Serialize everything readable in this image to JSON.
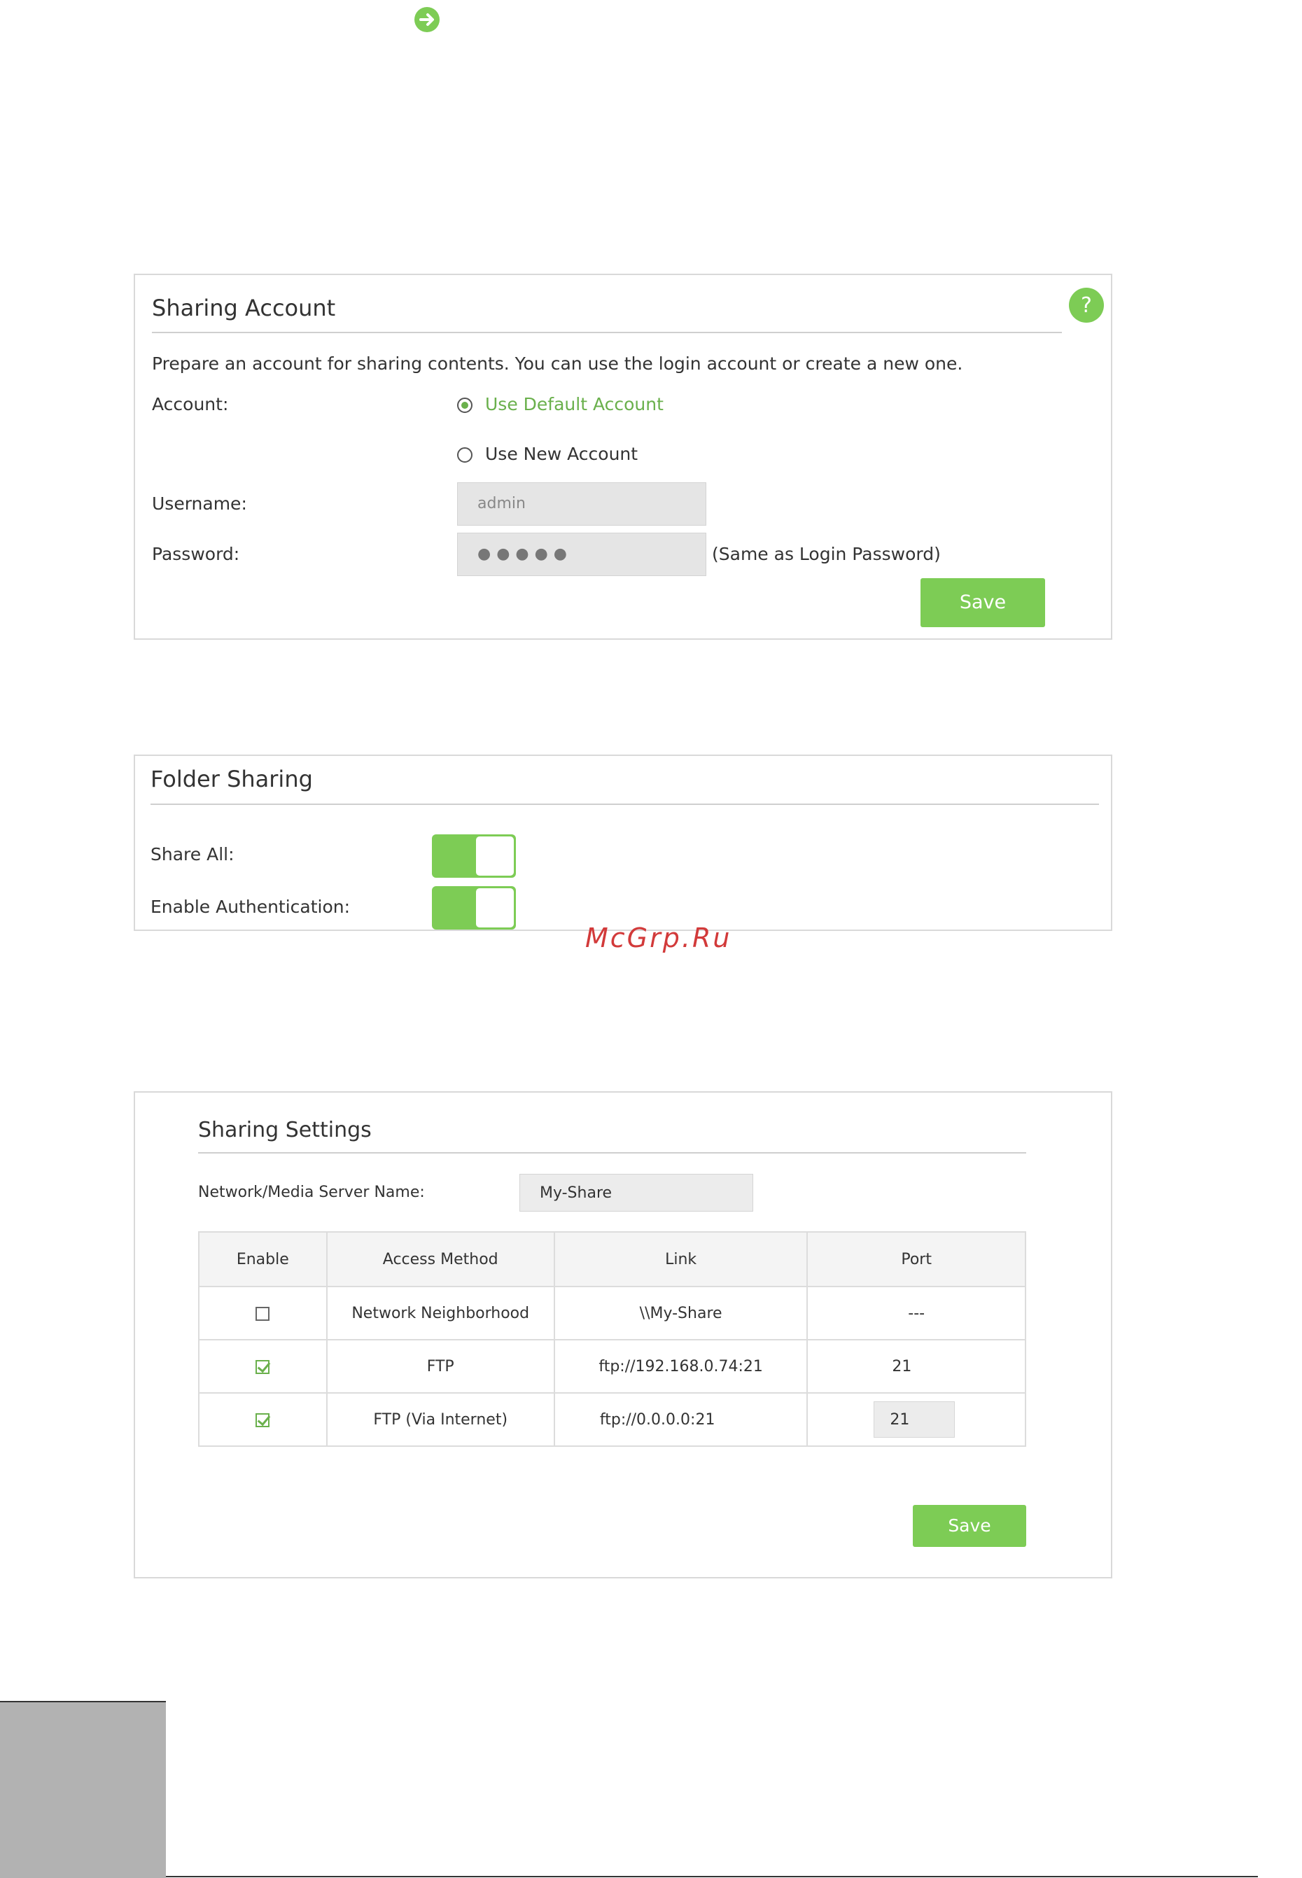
{
  "sharing_account": {
    "title": "Sharing Account",
    "description": "Prepare an account for sharing contents. You can use the login account or create a new one.",
    "account_label": "Account:",
    "option_default": "Use Default Account",
    "option_new": "Use New Account",
    "selected_option": "Use Default Account",
    "username_label": "Username:",
    "username_value": "admin",
    "password_label": "Password:",
    "password_value": "●●●●●",
    "password_note": "(Same as Login Password)",
    "save_label": "Save",
    "help_glyph": "?"
  },
  "folder_sharing": {
    "title": "Folder Sharing",
    "share_all_label": "Share All:",
    "share_all_on": true,
    "enable_auth_label": "Enable Authentication:",
    "enable_auth_on": true
  },
  "watermark": "McGrp.Ru",
  "sharing_settings": {
    "title": "Sharing Settings",
    "server_name_label": "Network/Media Server Name:",
    "server_name_value": "My-Share",
    "columns": [
      "Enable",
      "Access Method",
      "Link",
      "Port"
    ],
    "rows": [
      {
        "enabled": false,
        "method": "Network Neighborhood",
        "link": "\\\\My-Share",
        "port": "---"
      },
      {
        "enabled": true,
        "method": "FTP",
        "link": "ftp://192.168.0.74:21",
        "port": "21"
      },
      {
        "enabled": true,
        "method": "FTP (Via Internet)",
        "link": "ftp://0.0.0.0:21",
        "port": "21"
      }
    ],
    "save_label": "Save"
  },
  "colors": {
    "accent": "#7dcc55",
    "accent_text": "#6ab04c",
    "watermark": "#d23a3a"
  },
  "icons": {
    "top": "arrow-right-circle-icon",
    "help": "question-mark-icon"
  }
}
